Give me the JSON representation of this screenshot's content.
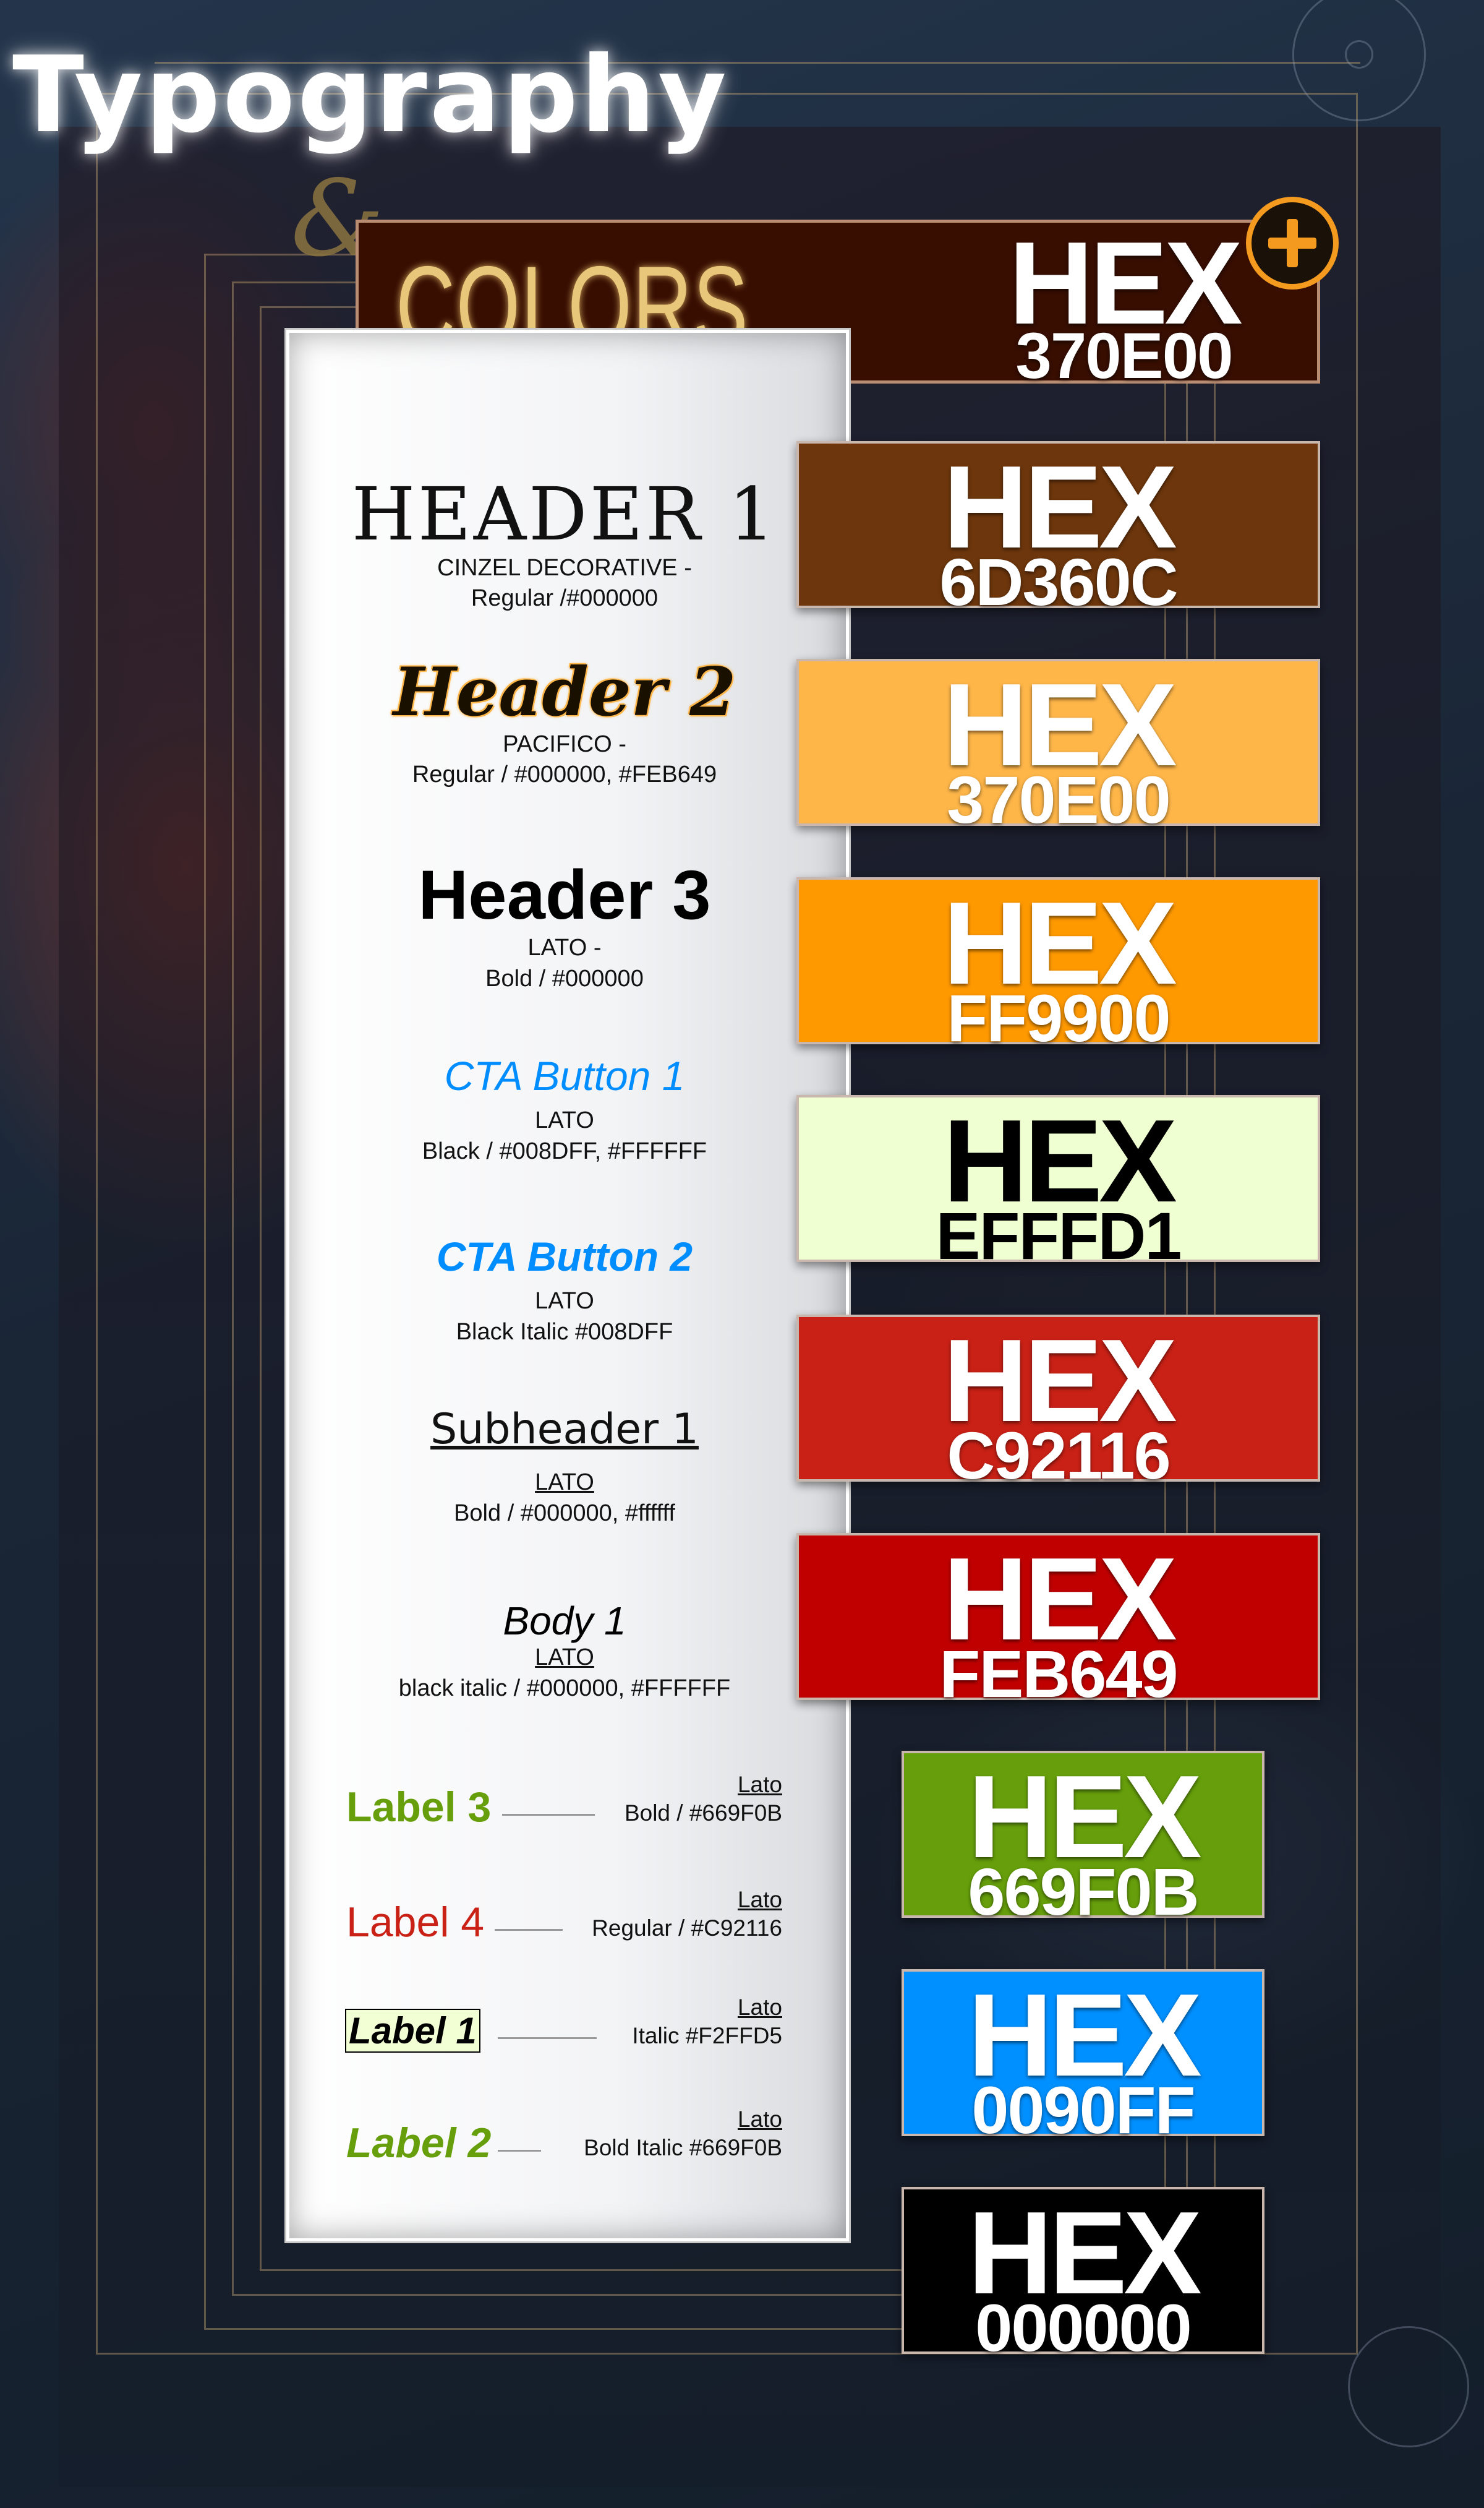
{
  "title": "Typography",
  "ampersand": "&",
  "colors_heading": "COLORS",
  "typography": {
    "header1": {
      "sample": "HEADER 1",
      "spec_line1": "CINZEL DECORATIVE -",
      "spec_line2": "Regular /#000000"
    },
    "header2": {
      "sample": "Header 2",
      "spec_line1": "PACIFICO -",
      "spec_line2": "Regular / #000000, #FEB649"
    },
    "header3": {
      "sample": "Header 3",
      "spec_line1": "LATO -",
      "spec_line2": "Bold / #000000"
    },
    "cta1": {
      "sample": "CTA Button 1",
      "spec_line1": "LATO",
      "spec_line2": "Black / #008DFF, #FFFFFF"
    },
    "cta2": {
      "sample": "CTA Button 2",
      "spec_line1": "LATO",
      "spec_line2": "Black Italic  #008DFF"
    },
    "subheader1": {
      "sample": "Subheader 1",
      "spec_line1": "LATO",
      "spec_line2": "Bold / #000000, #ffffff"
    },
    "body1": {
      "sample": "Body 1",
      "spec_line1": "LATO",
      "spec_line2": "black italic / #000000, #FFFFFF"
    },
    "labels": [
      {
        "name": "Label 3",
        "font": "Lato",
        "spec": "Bold / #669F0B",
        "color": "#669F0B"
      },
      {
        "name": "Label 4",
        "font": "Lato",
        "spec": "Regular / #C92116",
        "color": "#C92116"
      },
      {
        "name": "Label 1",
        "font": "Lato",
        "spec": "Italic  #F2FFD5",
        "color": "#000000"
      },
      {
        "name": "Label 2",
        "font": "Lato",
        "spec": "Bold Italic  #669F0B",
        "color": "#669F0B"
      }
    ]
  },
  "swatches": [
    {
      "word": "HEX",
      "code": "370E00",
      "bg": "#370E00"
    },
    {
      "word": "HEX",
      "code": "6D360C",
      "bg": "#6D360C"
    },
    {
      "word": "HEX",
      "code": "370E00",
      "bg": "#FEB649"
    },
    {
      "word": "HEX",
      "code": "FF9900",
      "bg": "#FF9900"
    },
    {
      "word": "HEX",
      "code": "EFFFD1",
      "bg": "#EFFFD1"
    },
    {
      "word": "HEX",
      "code": "C92116",
      "bg": "#C92116"
    },
    {
      "word": "HEX",
      "code": "FEB649",
      "bg": "#C00000"
    },
    {
      "word": "HEX",
      "code": "669F0B",
      "bg": "#669F0B"
    },
    {
      "word": "HEX",
      "code": "0090FF",
      "bg": "#0090FF"
    },
    {
      "word": "HEX",
      "code": "000000",
      "bg": "#000000"
    }
  ]
}
